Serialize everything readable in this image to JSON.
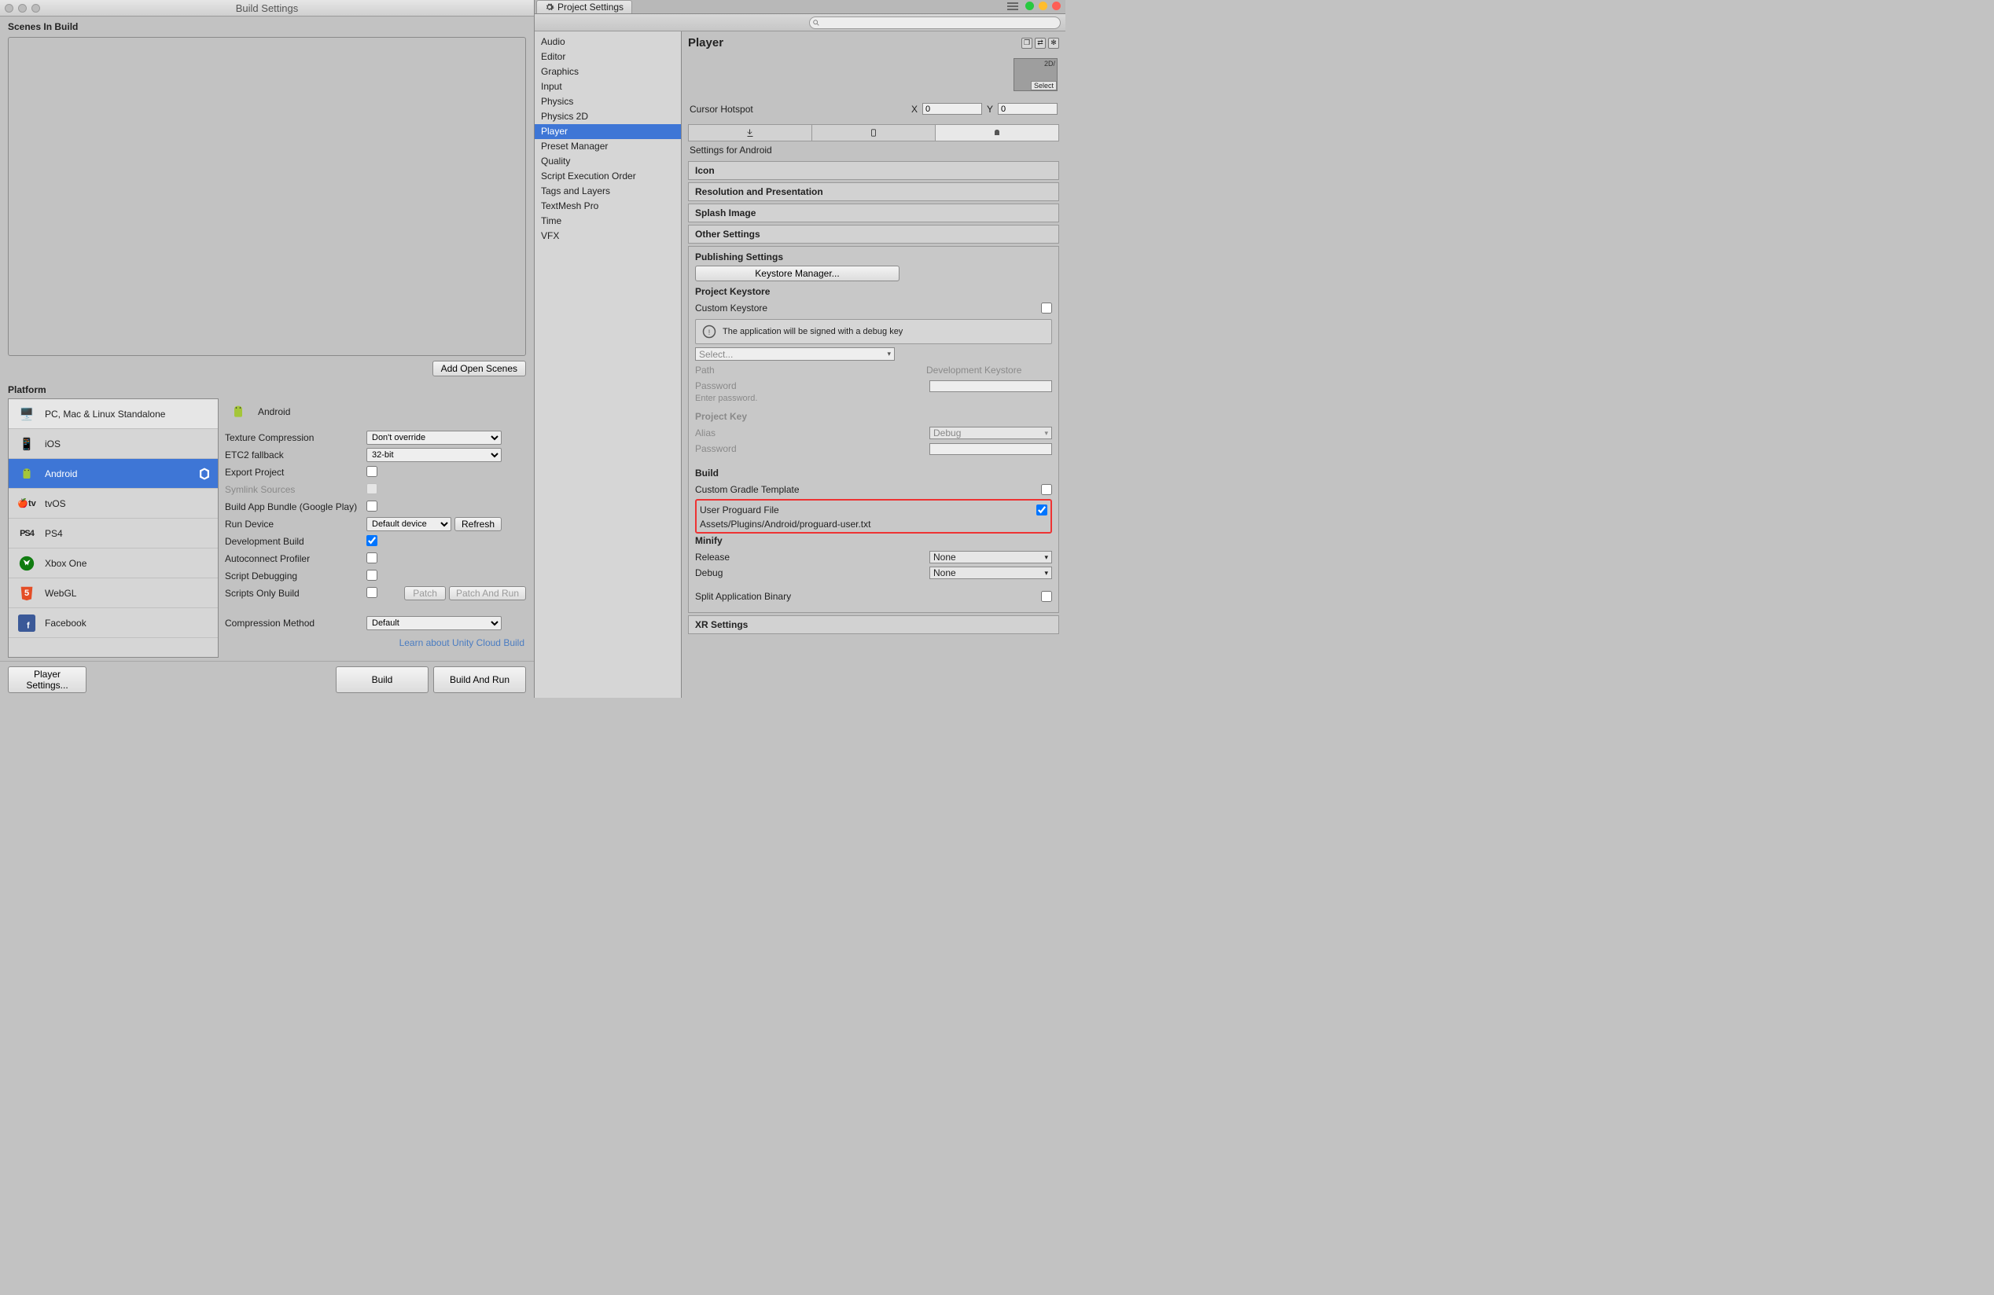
{
  "build": {
    "title": "Build Settings",
    "scenes_label": "Scenes In Build",
    "add_scenes": "Add Open Scenes",
    "platform_label": "Platform",
    "platforms": [
      "PC, Mac & Linux Standalone",
      "iOS",
      "Android",
      "tvOS",
      "PS4",
      "Xbox One",
      "WebGL",
      "Facebook"
    ],
    "selected_name": "Android",
    "tex_comp": {
      "label": "Texture Compression",
      "value": "Don't override"
    },
    "etc2": {
      "label": "ETC2 fallback",
      "value": "32-bit"
    },
    "export": "Export Project",
    "symlink": "Symlink Sources",
    "bundle": "Build App Bundle (Google Play)",
    "run_device": {
      "label": "Run Device",
      "value": "Default device",
      "refresh": "Refresh"
    },
    "dev_build": "Development Build",
    "autoconnect": "Autoconnect Profiler",
    "script_debug": "Script Debugging",
    "scripts_only": "Scripts Only Build",
    "patch": "Patch",
    "patch_run": "Patch And Run",
    "comp_method": {
      "label": "Compression Method",
      "value": "Default"
    },
    "cloud_link": "Learn about Unity Cloud Build",
    "player_settings": "Player Settings...",
    "build_btn": "Build",
    "build_run": "Build And Run"
  },
  "ps": {
    "tab": "Project Settings",
    "search_placeholder": "",
    "categories": [
      "Audio",
      "Editor",
      "Graphics",
      "Input",
      "Physics",
      "Physics 2D",
      "Player",
      "Preset Manager",
      "Quality",
      "Script Execution Order",
      "Tags and Layers",
      "TextMesh Pro",
      "Time",
      "VFX"
    ],
    "title": "Player",
    "thumb_select": "Select",
    "thumb_2d": "2D/",
    "hotspot": {
      "label": "Cursor Hotspot",
      "x": "X",
      "xv": "0",
      "y": "Y",
      "yv": "0"
    },
    "sfa": "Settings for Android",
    "sections": [
      "Icon",
      "Resolution and Presentation",
      "Splash Image",
      "Other Settings"
    ],
    "pub": {
      "title": "Publishing Settings",
      "keystore_mgr": "Keystore Manager...",
      "proj_ks": "Project Keystore",
      "custom_ks": "Custom Keystore",
      "debug_info": "The application will be signed with a debug key",
      "select": "Select...",
      "path": "Path",
      "path_v": "Development Keystore",
      "password": "Password",
      "pw_hint": "Enter password.",
      "proj_key": "Project Key",
      "alias": "Alias",
      "alias_v": "Debug",
      "build": "Build",
      "gradle": "Custom Gradle Template",
      "proguard": "User Proguard File",
      "proguard_path": "Assets/Plugins/Android/proguard-user.txt",
      "minify": "Minify",
      "release": "Release",
      "release_v": "None",
      "debug": "Debug",
      "debug_v": "None",
      "split": "Split Application Binary"
    },
    "xr": "XR Settings"
  }
}
